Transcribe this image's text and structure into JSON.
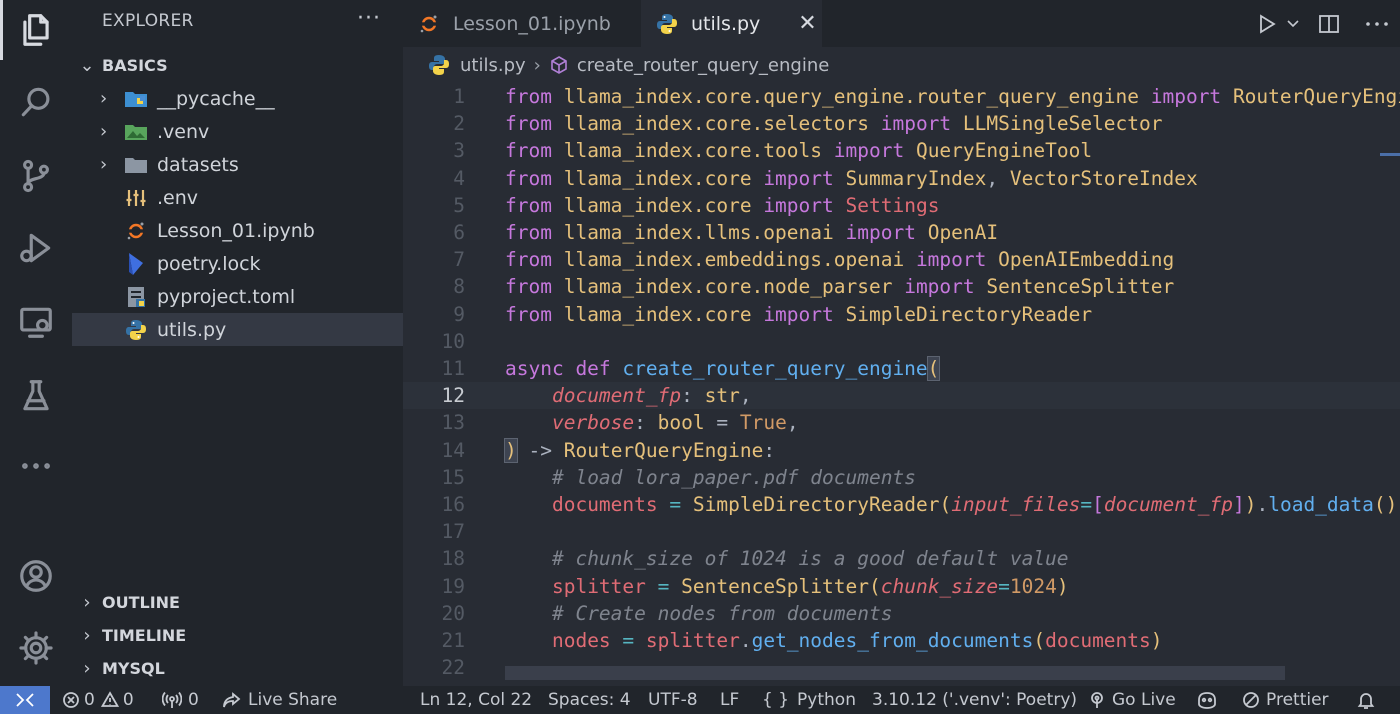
{
  "sidebar": {
    "title": "EXPLORER",
    "more": "···",
    "root": "BASICS",
    "items": [
      {
        "label": "__pycache__",
        "icon": "folder-pycache-icon",
        "chevron": "›"
      },
      {
        "label": ".venv",
        "icon": "folder-venv-icon",
        "chevron": "›"
      },
      {
        "label": "datasets",
        "icon": "folder-icon",
        "chevron": "›"
      },
      {
        "label": ".env",
        "icon": "env-settings-icon"
      },
      {
        "label": "Lesson_01.ipynb",
        "icon": "jupyter-icon"
      },
      {
        "label": "poetry.lock",
        "icon": "poetry-icon"
      },
      {
        "label": "pyproject.toml",
        "icon": "toml-file-icon"
      },
      {
        "label": "utils.py",
        "icon": "python-icon",
        "selected": true
      }
    ],
    "sections": [
      "OUTLINE",
      "TIMELINE",
      "MYSQL"
    ]
  },
  "tabs": [
    {
      "label": "Lesson_01.ipynb",
      "icon": "jupyter-icon",
      "active": false
    },
    {
      "label": "utils.py",
      "icon": "python-icon",
      "active": true,
      "close": "✕"
    }
  ],
  "breadcrumb": {
    "file": "utils.py",
    "separator": "›",
    "symbol": "create_router_query_engine"
  },
  "editor": {
    "current_line": 12,
    "line_numbers": [
      "1",
      "2",
      "3",
      "4",
      "5",
      "6",
      "7",
      "8",
      "9",
      "10",
      "11",
      "12",
      "13",
      "14",
      "15",
      "16",
      "17",
      "18",
      "19",
      "20",
      "21",
      "22"
    ]
  },
  "status": {
    "errors": "0",
    "warnings": "0",
    "ports": "0",
    "live_share": "Live Share",
    "position": "Ln 12, Col 22",
    "spaces": "Spaces: 4",
    "encoding": "UTF-8",
    "eol": "LF",
    "language": "Python",
    "interpreter": "3.10.12 ('.venv': Poetry)",
    "go_live": "Go Live",
    "prettier": "Prettier"
  },
  "colors": {
    "accent_blue": "#4d78cc",
    "keyword": "#c678dd",
    "function": "#61afef",
    "param": "#e06c75",
    "class": "#e5c07b",
    "comment": "#7f848e"
  }
}
